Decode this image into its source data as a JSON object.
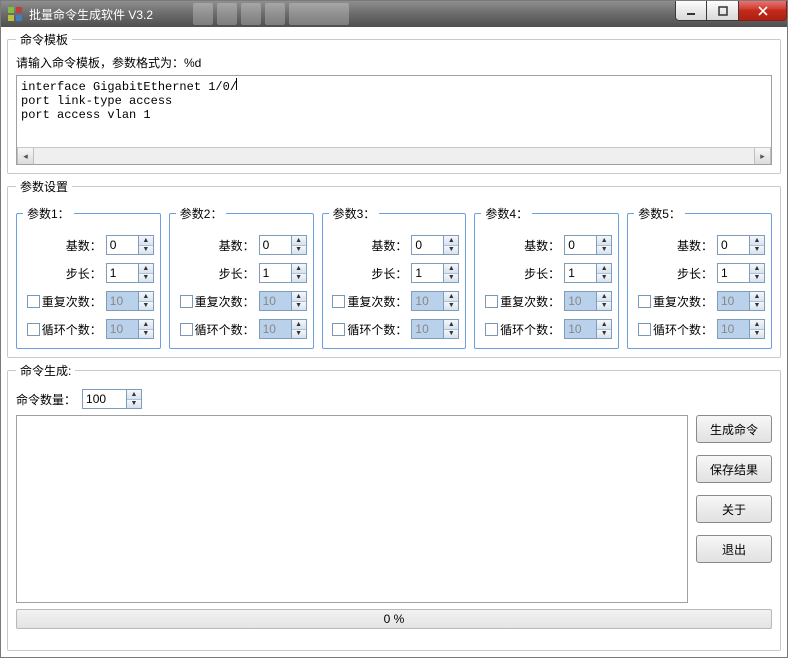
{
  "titlebar": {
    "title": "批量命令生成软件 V3.2"
  },
  "template_group": {
    "legend": "命令模板",
    "hint": "请输入命令模板，参数格式为：%d",
    "text_line1": "interface GigabitEthernet 1/0/",
    "text_rest": "port link-type access\nport access vlan 1"
  },
  "params_group": {
    "legend": "参数设置"
  },
  "param_labels": {
    "base": "基数：",
    "step": "步长：",
    "repeat": "重复次数：",
    "loop": "循环个数："
  },
  "params": [
    {
      "legend": "参数1：",
      "base": "0",
      "step": "1",
      "repeat": "10",
      "loop": "10"
    },
    {
      "legend": "参数2：",
      "base": "0",
      "step": "1",
      "repeat": "10",
      "loop": "10"
    },
    {
      "legend": "参数3：",
      "base": "0",
      "step": "1",
      "repeat": "10",
      "loop": "10"
    },
    {
      "legend": "参数4：",
      "base": "0",
      "step": "1",
      "repeat": "10",
      "loop": "10"
    },
    {
      "legend": "参数5：",
      "base": "0",
      "step": "1",
      "repeat": "10",
      "loop": "10"
    }
  ],
  "gen_group": {
    "legend": "命令生成:",
    "count_label": "命令数量：",
    "count_value": "100",
    "progress": "0 %"
  },
  "buttons": {
    "generate": "生成命令",
    "save": "保存结果",
    "about": "关于",
    "exit": "退出"
  }
}
